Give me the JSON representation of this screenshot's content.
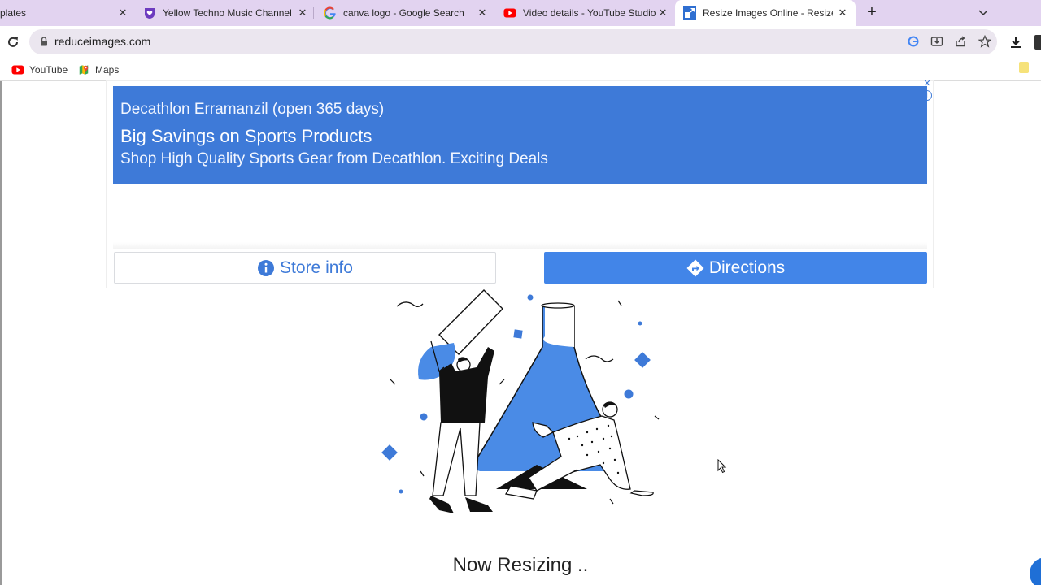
{
  "browser": {
    "tabs": [
      {
        "title": "plates",
        "favicon": "blank"
      },
      {
        "title": "Yellow Techno Music Channel Yo",
        "favicon": "heart-shield-icon"
      },
      {
        "title": "canva logo - Google Search",
        "favicon": "google-g-icon"
      },
      {
        "title": "Video details - YouTube Studio",
        "favicon": "youtube-icon"
      },
      {
        "title": "Resize Images Online - Resize JP",
        "favicon": "resize-icon",
        "active": true
      }
    ],
    "url": "reduceimages.com",
    "bookmarks": [
      {
        "label": "YouTube",
        "icon": "youtube-icon"
      },
      {
        "label": "Maps",
        "icon": "maps-icon"
      }
    ]
  },
  "ad": {
    "line1": "Decathlon Erramanzil (open 365 days)",
    "line2": "Big Savings on Sports Products",
    "line3": "Shop High Quality Sports Gear from Decathlon. Exciting Deals",
    "store_info_label": "Store info",
    "directions_label": "Directions",
    "colors": {
      "banner": "#3e7ad8",
      "directions_button": "#4285e8"
    }
  },
  "page": {
    "status_text": "Now Resizing .."
  }
}
